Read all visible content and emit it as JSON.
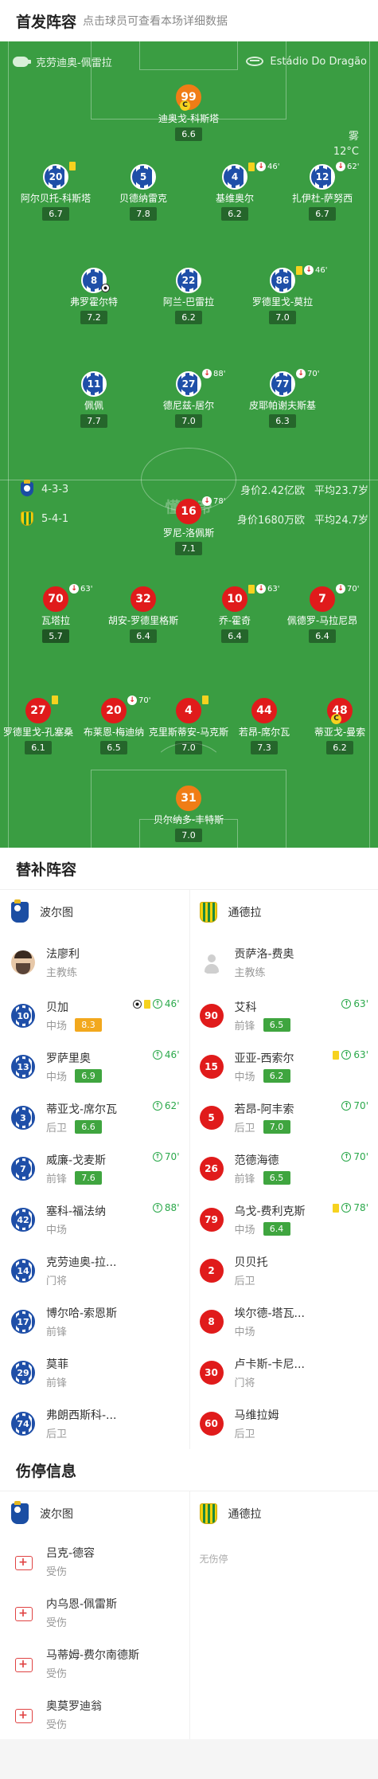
{
  "lineup": {
    "title": "首发阵容",
    "subtitle": "点击球员可查看本场详细数据"
  },
  "pitch": {
    "referee": "克劳迪奥-佩雷拉",
    "stadium": "Estádio Do Dragão",
    "weather": "雾",
    "temperature": "12°C",
    "watermark": "懂球帝",
    "home_info": {
      "formation": "4-3-3",
      "value": "身价2.42亿欧",
      "age": "平均23.7岁"
    },
    "away_info": {
      "formation": "5-4-1",
      "value": "身价1680万欧",
      "age": "平均24.7岁"
    },
    "players": [
      {
        "id": "p1",
        "num": "99",
        "name": "迪奥戈-科斯塔",
        "rating": "6.6",
        "kind": "gk",
        "captain": "C"
      },
      {
        "id": "p2",
        "num": "20",
        "name": "阿尔贝托-科斯塔",
        "rating": "6.7",
        "kind": "home",
        "evt": "ycard"
      },
      {
        "id": "p3",
        "num": "5",
        "name": "贝德纳雷克",
        "rating": "7.8",
        "kind": "home"
      },
      {
        "id": "p4",
        "num": "4",
        "name": "基维奥尔",
        "rating": "6.2",
        "kind": "home",
        "evt": "ycard,out",
        "min": "46'"
      },
      {
        "id": "p5",
        "num": "12",
        "name": "扎伊杜-萨努西",
        "rating": "6.7",
        "kind": "home",
        "evt": "out",
        "min": "62'"
      },
      {
        "id": "p6",
        "num": "8",
        "name": "弗罗霍尔特",
        "rating": "7.2",
        "kind": "home",
        "ball": true
      },
      {
        "id": "p7",
        "num": "22",
        "name": "阿兰-巴雷拉",
        "rating": "6.2",
        "kind": "home"
      },
      {
        "id": "p8",
        "num": "86",
        "name": "罗德里戈-莫拉",
        "rating": "7.0",
        "kind": "home",
        "evt": "ycard,out",
        "min": "46'"
      },
      {
        "id": "p9",
        "num": "11",
        "name": "佩佩",
        "rating": "7.7",
        "kind": "home"
      },
      {
        "id": "p10",
        "num": "27",
        "name": "德尼兹-居尔",
        "rating": "7.0",
        "kind": "home",
        "evt": "out",
        "min": "88'"
      },
      {
        "id": "p11",
        "num": "77",
        "name": "皮耶帕谢夫斯基",
        "rating": "6.3",
        "kind": "home",
        "evt": "out",
        "min": "70'"
      },
      {
        "id": "a1",
        "num": "16",
        "name": "罗尼-洛佩斯",
        "rating": "7.1",
        "kind": "away",
        "evt": "out",
        "min": "78'"
      },
      {
        "id": "a2",
        "num": "70",
        "name": "瓦塔拉",
        "rating": "5.7",
        "kind": "away",
        "evt": "out",
        "min": "63'",
        "grey": true
      },
      {
        "id": "a3",
        "num": "32",
        "name": "胡安-罗德里格斯",
        "rating": "6.4",
        "kind": "away"
      },
      {
        "id": "a4",
        "num": "10",
        "name": "乔-霍奇",
        "rating": "6.4",
        "kind": "away",
        "evt": "ycard,out",
        "min": "63'"
      },
      {
        "id": "a5",
        "num": "7",
        "name": "佩德罗-马拉尼昂",
        "rating": "6.4",
        "kind": "away",
        "evt": "out",
        "min": "70'"
      },
      {
        "id": "a6",
        "num": "27",
        "name": "罗德里戈-孔塞桑",
        "rating": "6.1",
        "kind": "away",
        "evt": "ycard"
      },
      {
        "id": "a7",
        "num": "20",
        "name": "布莱恩-梅迪纳",
        "rating": "6.5",
        "kind": "away",
        "evt": "out",
        "min": "70'"
      },
      {
        "id": "a8",
        "num": "4",
        "name": "克里斯蒂安-马克斯",
        "rating": "7.0",
        "kind": "away",
        "evt": "ycard"
      },
      {
        "id": "a9",
        "num": "44",
        "name": "若昂-席尔瓦",
        "rating": "7.3",
        "kind": "away"
      },
      {
        "id": "a10",
        "num": "48",
        "name": "蒂亚戈-曼索",
        "rating": "6.2",
        "kind": "away",
        "captain": "C"
      },
      {
        "id": "a11",
        "num": "31",
        "name": "贝尔纳多-丰特斯",
        "rating": "7.0",
        "kind": "gk"
      }
    ]
  },
  "subs": {
    "title": "替补阵容",
    "home_team": "波尔图",
    "away_team": "通德拉",
    "home_coach": {
      "name": "法廖利",
      "role": "主教练"
    },
    "away_coach": {
      "name": "贡萨洛-费奥",
      "role": "主教练"
    },
    "home": [
      {
        "num": "10",
        "name": "贝加",
        "pos": "中场",
        "rating": "8.3",
        "rc": "o",
        "ball": true,
        "ycard": true,
        "min": "46'"
      },
      {
        "num": "13",
        "name": "罗萨里奥",
        "pos": "中场",
        "rating": "6.9",
        "rc": "g",
        "min": "46'"
      },
      {
        "num": "3",
        "name": "蒂亚戈-席尔瓦",
        "pos": "后卫",
        "rating": "6.6",
        "rc": "g",
        "min": "62'"
      },
      {
        "num": "7",
        "name": "威廉-戈麦斯",
        "pos": "前锋",
        "rating": "7.6",
        "rc": "g",
        "min": "70'"
      },
      {
        "num": "42",
        "name": "塞科-福法纳",
        "pos": "中场",
        "min": "88'"
      },
      {
        "num": "14",
        "name": "克劳迪奥-拉...",
        "pos": "门将"
      },
      {
        "num": "17",
        "name": "博尔哈-索恩斯",
        "pos": "前锋"
      },
      {
        "num": "29",
        "name": "莫菲",
        "pos": "前锋"
      },
      {
        "num": "74",
        "name": "弗朗西斯科-...",
        "pos": "后卫"
      }
    ],
    "away": [
      {
        "num": "90",
        "name": "艾科",
        "pos": "前锋",
        "rating": "6.5",
        "rc": "g",
        "min": "63'"
      },
      {
        "num": "15",
        "name": "亚亚-西索尔",
        "pos": "中场",
        "rating": "6.2",
        "rc": "g",
        "ycard": true,
        "min": "63'"
      },
      {
        "num": "5",
        "name": "若昂-阿丰索",
        "pos": "后卫",
        "rating": "7.0",
        "rc": "g",
        "min": "70'"
      },
      {
        "num": "26",
        "name": "范德海德",
        "pos": "前锋",
        "rating": "6.5",
        "rc": "g",
        "min": "70'"
      },
      {
        "num": "79",
        "name": "乌戈-费利克斯",
        "pos": "中场",
        "rating": "6.4",
        "rc": "g",
        "ycard": true,
        "min": "78'"
      },
      {
        "num": "2",
        "name": "贝贝托",
        "pos": "后卫"
      },
      {
        "num": "8",
        "name": "埃尔德-塔瓦...",
        "pos": "中场"
      },
      {
        "num": "30",
        "name": "卢卡斯-卡尼...",
        "pos": "门将"
      },
      {
        "num": "60",
        "name": "马维拉姆",
        "pos": "后卫"
      }
    ]
  },
  "injuries": {
    "title": "伤停信息",
    "home_team": "波尔图",
    "away_team": "通德拉",
    "none_text": "无伤停",
    "home": [
      {
        "name": "吕克-德容",
        "status": "受伤"
      },
      {
        "name": "内乌恩-佩雷斯",
        "status": "受伤"
      },
      {
        "name": "马蒂姆-费尔南德斯",
        "status": "受伤"
      },
      {
        "name": "奥莫罗迪翁",
        "status": "受伤"
      }
    ]
  }
}
